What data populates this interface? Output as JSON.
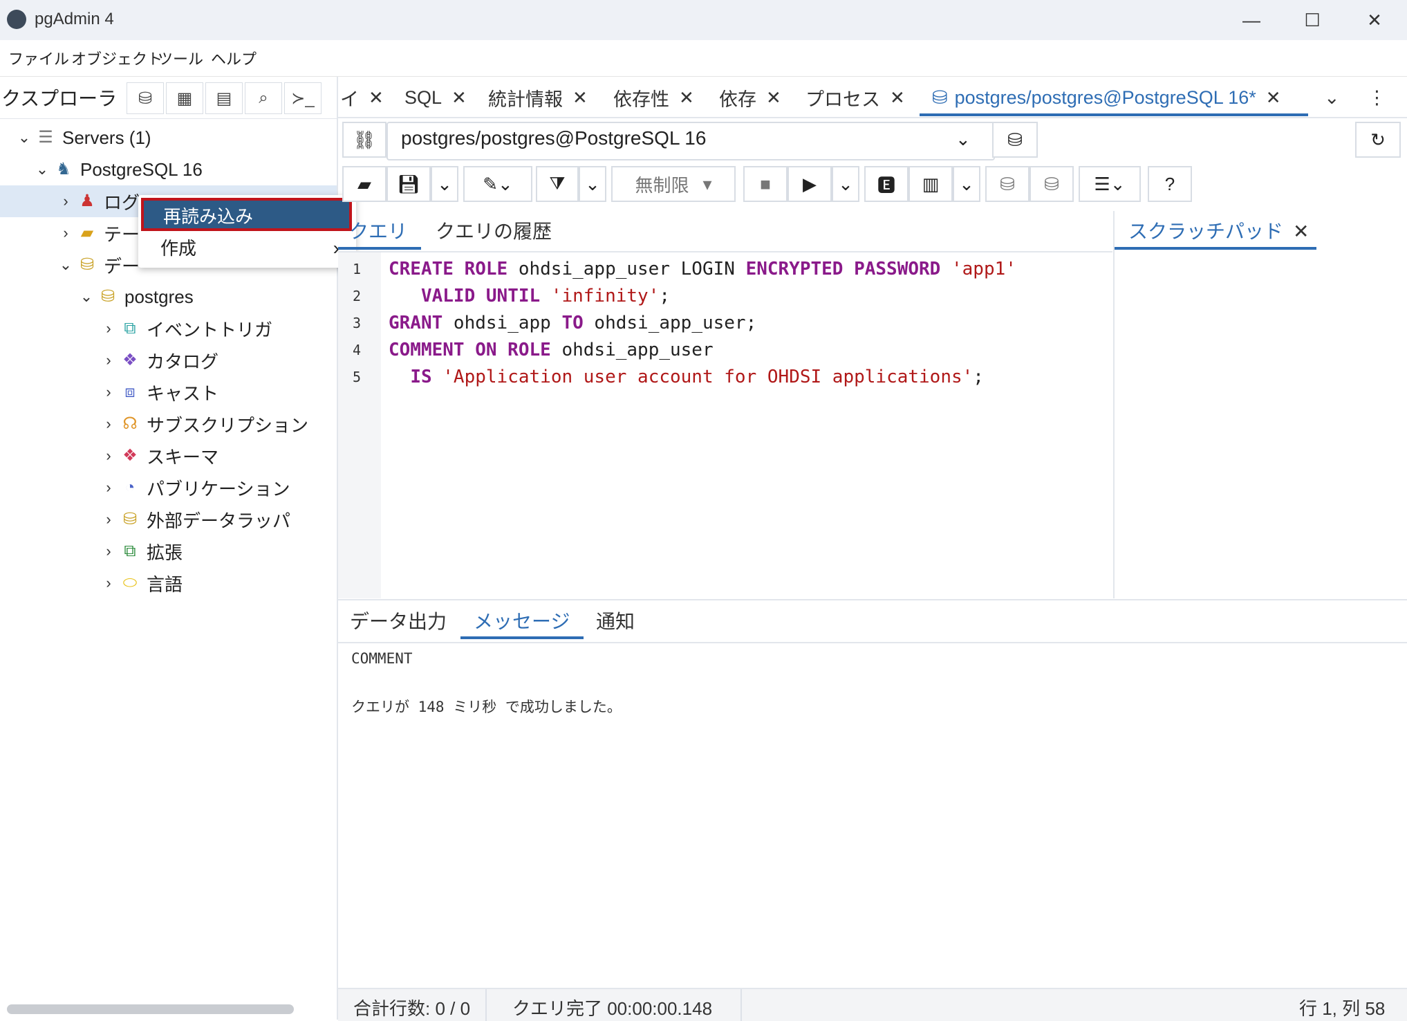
{
  "window": {
    "title": "pgAdmin 4"
  },
  "menu": {
    "items": [
      "ファイル",
      "オブジェクト",
      "ツール",
      "ヘルプ"
    ]
  },
  "explorer": {
    "title": "クスプローラ",
    "tree": {
      "servers": "Servers (1)",
      "server": "PostgreSQL 16",
      "login": "ログ",
      "tablespace": "テー",
      "databases": "デー",
      "db": "postgres",
      "children": [
        "イベントトリガ",
        "カタログ",
        "キャスト",
        "サブスクリプション",
        "スキーマ",
        "パブリケーション",
        "外部データラッパ",
        "拡張",
        "言語"
      ]
    }
  },
  "context_menu": {
    "reload": "再読み込み",
    "create": "作成"
  },
  "tabs": {
    "items": [
      "イ",
      "SQL",
      "統計情報",
      "依存性",
      "依存",
      "プロセス"
    ],
    "active": "postgres/postgres@PostgreSQL 16*"
  },
  "connection": {
    "value": "postgres/postgres@PostgreSQL 16"
  },
  "toolbar": {
    "limit": "無制限"
  },
  "editor_tabs": {
    "query": "クエリ",
    "history": "クエリの履歴",
    "scratch": "スクラッチパッド"
  },
  "code": {
    "line_numbers": [
      "1",
      "2",
      "3",
      "4",
      "5"
    ]
  },
  "output_tabs": {
    "data": "データ出力",
    "messages": "メッセージ",
    "notify": "通知"
  },
  "output": {
    "line1": "COMMENT",
    "line2": "クエリが 148 ミリ秒 で成功しました。"
  },
  "status": {
    "rows": "合計行数: 0 / 0",
    "query": "クエリ完了 00:00:00.148",
    "position": "行 1, 列 58"
  }
}
